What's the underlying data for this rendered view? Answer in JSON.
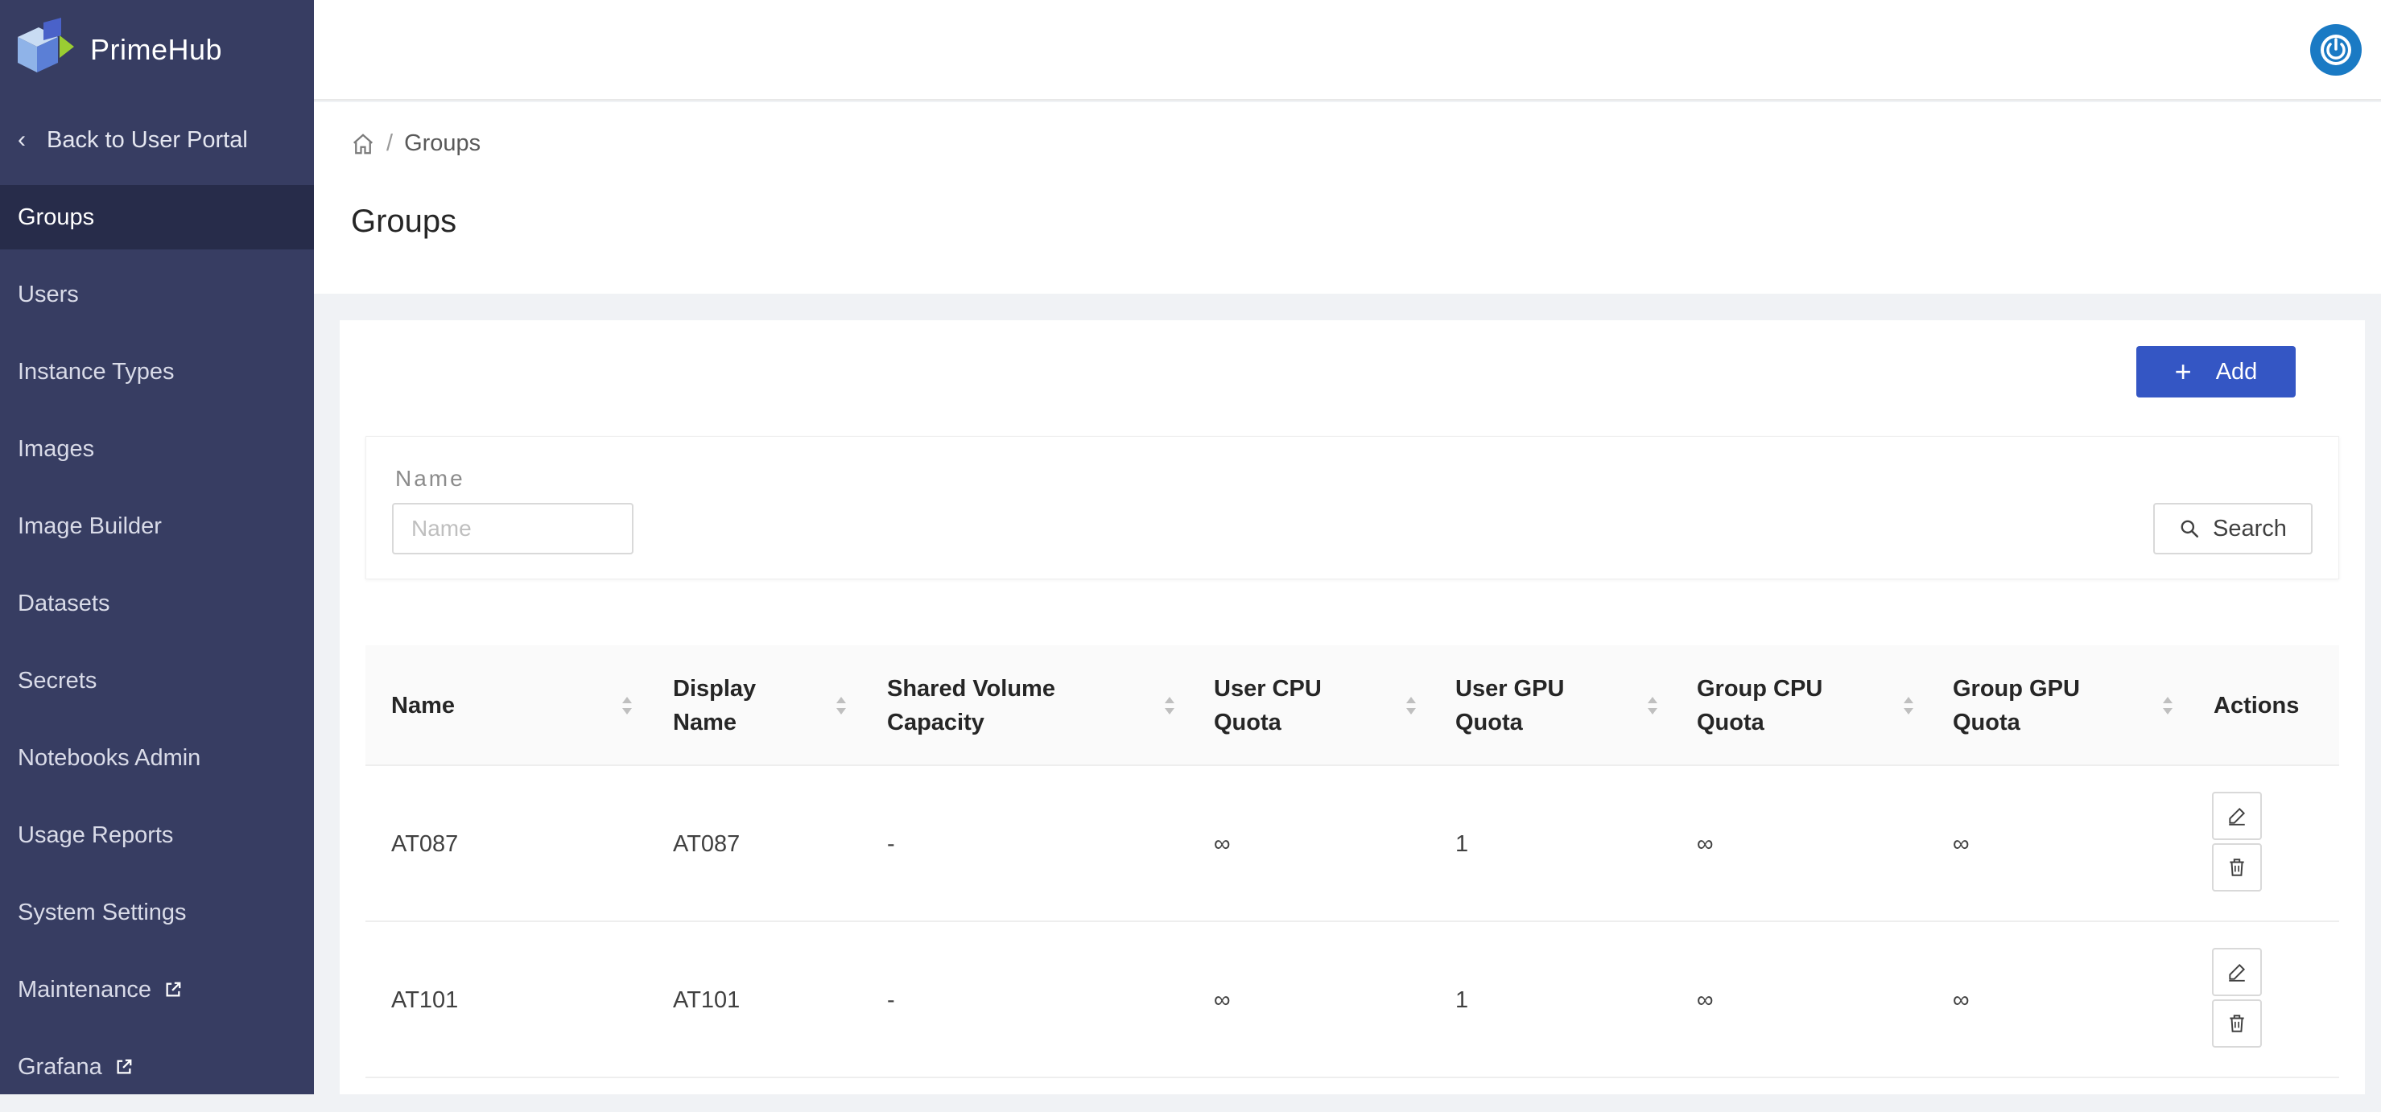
{
  "app": {
    "name": "PrimeHub"
  },
  "sidebar": {
    "back_label": "Back to User Portal",
    "items": [
      {
        "label": "Groups",
        "active": true
      },
      {
        "label": "Users"
      },
      {
        "label": "Instance Types"
      },
      {
        "label": "Images"
      },
      {
        "label": "Image Builder"
      },
      {
        "label": "Datasets"
      },
      {
        "label": "Secrets"
      },
      {
        "label": "Notebooks Admin"
      },
      {
        "label": "Usage Reports"
      },
      {
        "label": "System Settings"
      },
      {
        "label": "Maintenance",
        "external": true
      },
      {
        "label": "Grafana",
        "external": true
      }
    ]
  },
  "breadcrumb": {
    "current": "Groups"
  },
  "page": {
    "title": "Groups"
  },
  "toolbar": {
    "add_label": "Add"
  },
  "filter": {
    "name_label": "Name",
    "name_placeholder": "Name",
    "search_label": "Search"
  },
  "table": {
    "columns": [
      {
        "l1": "Name",
        "l2": ""
      },
      {
        "l1": "Display",
        "l2": "Name"
      },
      {
        "l1": "Shared Volume",
        "l2": "Capacity"
      },
      {
        "l1": "User CPU",
        "l2": "Quota"
      },
      {
        "l1": "User GPU",
        "l2": "Quota"
      },
      {
        "l1": "Group CPU",
        "l2": "Quota"
      },
      {
        "l1": "Group GPU",
        "l2": "Quota"
      },
      {
        "l1": "Actions",
        "l2": ""
      }
    ],
    "rows": [
      {
        "name": "AT087",
        "display_name": "AT087",
        "shared_volume": "-",
        "user_cpu": "∞",
        "user_gpu": "1",
        "group_cpu": "∞",
        "group_gpu": "∞"
      },
      {
        "name": "AT101",
        "display_name": "AT101",
        "shared_volume": "-",
        "user_cpu": "∞",
        "user_gpu": "1",
        "group_cpu": "∞",
        "group_gpu": "∞"
      }
    ]
  },
  "colors": {
    "sidebar": "#373d62",
    "sidebar_active": "#272c4a",
    "primary": "#3456c4",
    "power": "#1a7ac4"
  }
}
